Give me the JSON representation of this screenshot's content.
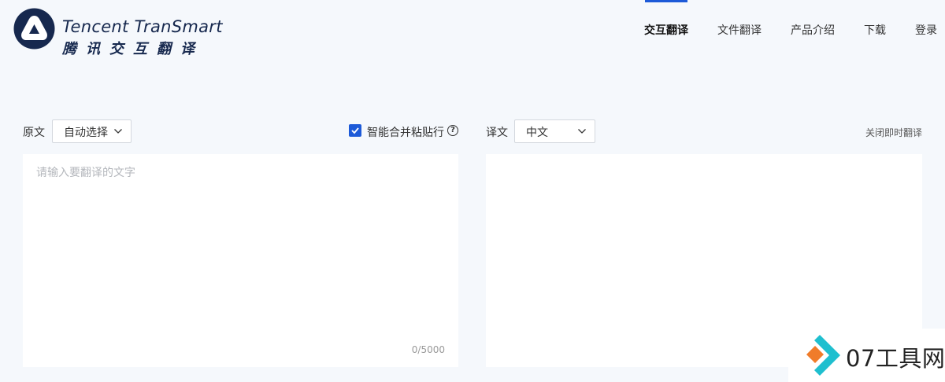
{
  "brand": {
    "name_en": "Tencent TranSmart",
    "name_cn": "腾讯交互翻译",
    "color": "#16284e"
  },
  "nav": {
    "items": [
      {
        "label": "交互翻译",
        "active": true
      },
      {
        "label": "文件翻译",
        "active": false
      },
      {
        "label": "产品介绍",
        "active": false
      },
      {
        "label": "下载",
        "active": false
      },
      {
        "label": "登录",
        "active": false
      }
    ],
    "accent": "#1d5ad8"
  },
  "source": {
    "label": "原文",
    "language": "自动选择",
    "placeholder": "请输入要翻译的文字",
    "value": "",
    "char_count": "0/5000"
  },
  "options": {
    "merge_paste_label": "智能合并粘贴行",
    "merge_paste_checked": true,
    "help_icon": "?"
  },
  "target": {
    "label": "译文",
    "language": "中文",
    "close_instant_label": "关闭即时翻译",
    "value": ""
  },
  "watermark": {
    "text": "07工具网"
  }
}
